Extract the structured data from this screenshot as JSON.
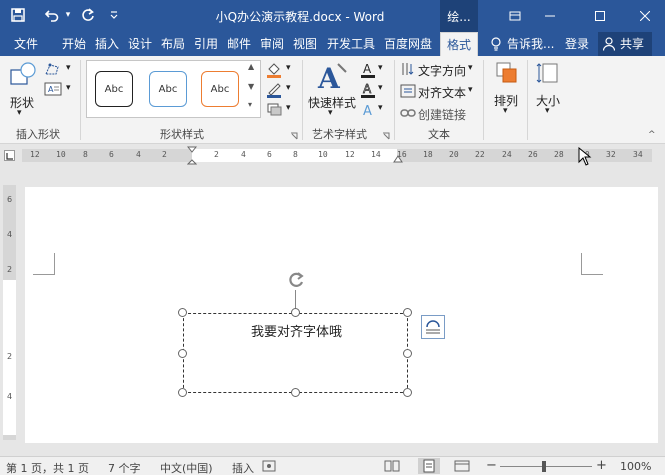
{
  "titlebar": {
    "title": "小Q办公演示教程.docx - Word",
    "context_tab": "绘...",
    "save_icon": "save-icon",
    "undo_icon": "undo-icon",
    "redo_icon": "redo-icon",
    "customize_icon": "customize-qat-icon"
  },
  "tabs": {
    "file": "文件",
    "items": [
      "开始",
      "插入",
      "设计",
      "布局",
      "引用",
      "邮件",
      "审阅",
      "视图",
      "开发工具",
      "百度网盘"
    ],
    "active": "格式",
    "tell_me": "告诉我...",
    "login": "登录",
    "share": "共享"
  },
  "ribbon": {
    "insert_shapes": {
      "shape_label": "形状",
      "group_label": "插入形状"
    },
    "shape_styles": {
      "swatch_text": "Abc",
      "group_label": "形状样式",
      "swatch_colors": [
        "#222222",
        "#5b9bd5",
        "#ed7d31"
      ]
    },
    "wordart": {
      "quick_styles": "快速样式",
      "group_label": "艺术字样式"
    },
    "text": {
      "direction": "文字方向",
      "align": "对齐文本",
      "link": "创建链接",
      "group_label": "文本"
    },
    "arrange": {
      "label": "排列"
    },
    "size": {
      "label": "大小"
    }
  },
  "ruler": {
    "h_ticks": [
      "12",
      "10",
      "8",
      "6",
      "4",
      "2",
      "2",
      "4",
      "6",
      "8",
      "10",
      "12",
      "14",
      "16",
      "18",
      "20",
      "22",
      "24",
      "26",
      "28",
      "30",
      "32",
      "34"
    ],
    "v_ticks": [
      "6",
      "4",
      "2",
      "2",
      "4"
    ]
  },
  "document": {
    "textbox_text": "我要对齐字体哦"
  },
  "statusbar": {
    "page": "第 1 页，共 1 页",
    "words": "7 个字",
    "language": "中文(中国)",
    "mode": "插入",
    "zoom_level": "100%",
    "zoom_minus": "−",
    "zoom_plus": "+"
  }
}
